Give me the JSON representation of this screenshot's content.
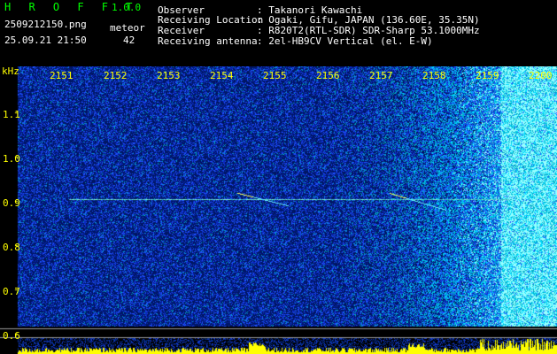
{
  "header": {
    "app_title": "H R O F F T",
    "version": "1.0.0",
    "filename": "2509212150.png",
    "datetime": "25.09.21 21:50",
    "meteor_label": "meteor",
    "meteor_count": "42",
    "info": [
      {
        "label": "Observer",
        "value": ": Takanori Kawachi"
      },
      {
        "label": "Receiving Location",
        "value": ": Ogaki, Gifu, JAPAN (136.60E, 35.35N)"
      },
      {
        "label": "Receiver",
        "value": ": R820T2(RTL-SDR) SDR-Sharp 53.1000MHz"
      },
      {
        "label": "Receiving antenna",
        "value": ": 2el-HB9CV Vertical (el. E-W)"
      }
    ]
  },
  "axes": {
    "y_unit": "kHz",
    "x_ticks": [
      "2151",
      "2152",
      "2153",
      "2154",
      "2155",
      "2156",
      "2157",
      "2158",
      "2159",
      "2200"
    ],
    "y_ticks": [
      "1.1",
      "1.0",
      "0.9",
      "0.8",
      "0.7",
      "0.6"
    ]
  },
  "colors": {
    "background": "#000000",
    "noise_dark": "#001a6e",
    "noise_mid": "#1f4fff",
    "noise_hot": "#00e0ff",
    "signal": "#ffff00",
    "text_green": "#00ff00",
    "text_yellow": "#ffff00"
  }
}
